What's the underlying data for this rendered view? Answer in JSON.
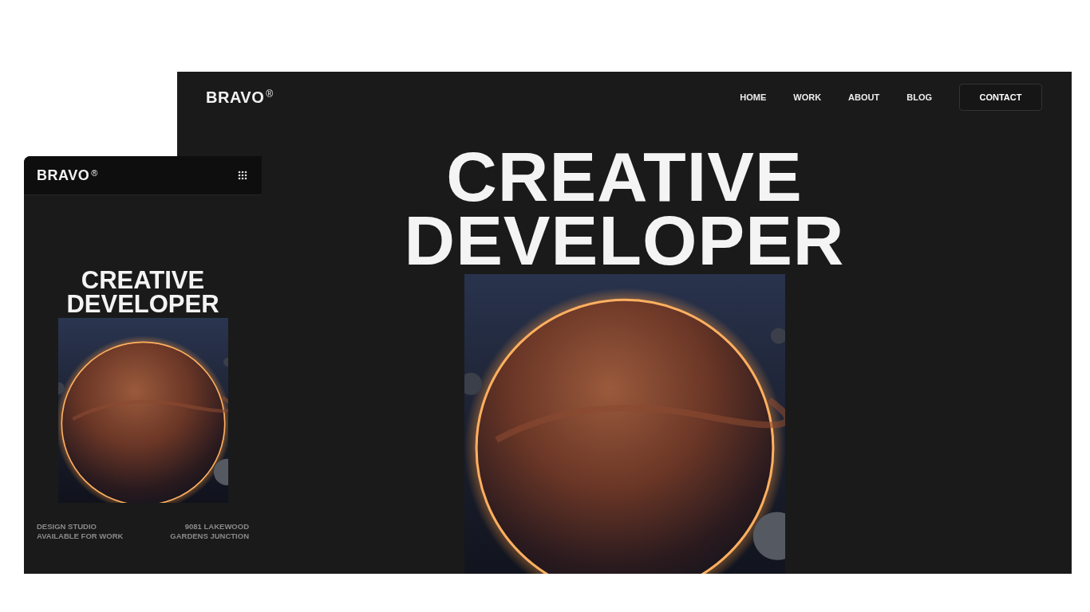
{
  "desktop": {
    "logo": "BRAVO",
    "logo_mark": "®",
    "nav": [
      {
        "label": "HOME"
      },
      {
        "label": "WORK"
      },
      {
        "label": "ABOUT"
      },
      {
        "label": "BLOG"
      }
    ],
    "contact_button": "CONTACT",
    "headline": [
      "CREATIVE",
      "DEVELOPER"
    ]
  },
  "mobile": {
    "logo": "BRAVO",
    "logo_mark": "®",
    "headline": [
      "CREATIVE",
      "DEVELOPER"
    ],
    "footer_left": [
      "DESIGN STUDIO",
      "AVAILABLE FOR WORK"
    ],
    "footer_right": [
      "9081 LAKEWOOD",
      "GARDENS JUNCTION"
    ]
  }
}
